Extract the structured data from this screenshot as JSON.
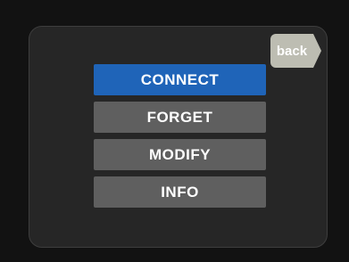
{
  "menu": {
    "items": [
      {
        "label": "CONNECT",
        "selected": true
      },
      {
        "label": "FORGET",
        "selected": false
      },
      {
        "label": "MODIFY",
        "selected": false
      },
      {
        "label": "INFO",
        "selected": false
      }
    ]
  },
  "back": {
    "label": "back"
  },
  "colors": {
    "background": "#121212",
    "panel": "#262626",
    "selected": "#1f64b8",
    "item": "#5f5f5f",
    "back_button": "#bdbdb2",
    "text": "#ffffff"
  }
}
